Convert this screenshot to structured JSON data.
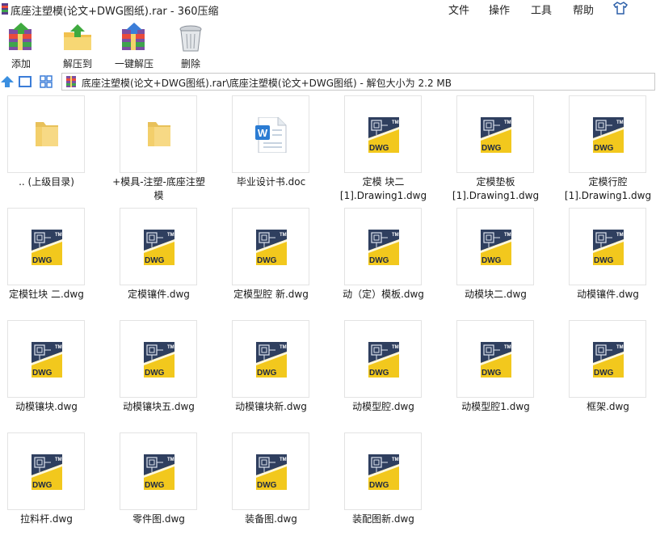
{
  "window": {
    "title": "底座注塑模(论文+DWG图纸).rar - 360压缩"
  },
  "menu": {
    "file": "文件",
    "operate": "操作",
    "tools": "工具",
    "help": "帮助"
  },
  "toolbar": {
    "add": "添加",
    "extract_to": "解压到",
    "one_click_extract": "一键解压",
    "delete": "删除"
  },
  "address": {
    "path": "底座注塑模(论文+DWG图纸).rar\\底座注塑模(论文+DWG图纸) - 解包大小为 2.2 MB"
  },
  "files": [
    {
      "name": ".. (上级目录)",
      "type": "folder"
    },
    {
      "name": "+模具-注塑-底座注塑模",
      "type": "folder"
    },
    {
      "name": "毕业设计书.doc",
      "type": "doc"
    },
    {
      "name": "定模 块二 [1].Drawing1.dwg",
      "type": "dwg"
    },
    {
      "name": "定模垫板 [1].Drawing1.dwg",
      "type": "dwg"
    },
    {
      "name": "定模行腔 [1].Drawing1.dwg",
      "type": "dwg"
    },
    {
      "name": "定模钍块 二.dwg",
      "type": "dwg"
    },
    {
      "name": "定模镶件.dwg",
      "type": "dwg"
    },
    {
      "name": "定模型腔 新.dwg",
      "type": "dwg"
    },
    {
      "name": "动（定）模板.dwg",
      "type": "dwg"
    },
    {
      "name": "动模块二.dwg",
      "type": "dwg"
    },
    {
      "name": "动模镶件.dwg",
      "type": "dwg"
    },
    {
      "name": "动模镶块.dwg",
      "type": "dwg"
    },
    {
      "name": "动模镶块五.dwg",
      "type": "dwg"
    },
    {
      "name": "动模镶块新.dwg",
      "type": "dwg"
    },
    {
      "name": "动模型腔.dwg",
      "type": "dwg"
    },
    {
      "name": "动模型腔1.dwg",
      "type": "dwg"
    },
    {
      "name": "框架.dwg",
      "type": "dwg"
    },
    {
      "name": "拉料杆.dwg",
      "type": "dwg"
    },
    {
      "name": "零件图.dwg",
      "type": "dwg"
    },
    {
      "name": "装备图.dwg",
      "type": "dwg"
    },
    {
      "name": "装配图新.dwg",
      "type": "dwg"
    }
  ],
  "icons": {
    "folder": "folder-icon",
    "doc": "word-doc-icon",
    "dwg": "dwg-file-icon",
    "dwg_label": "DWG",
    "dwg_tm": "TM",
    "doc_letter": "W"
  },
  "colors": {
    "folder": "#f5d77a",
    "dwg_dark": "#2f3f5f",
    "dwg_yellow": "#f2c81d",
    "word": "#2b7cd3"
  }
}
